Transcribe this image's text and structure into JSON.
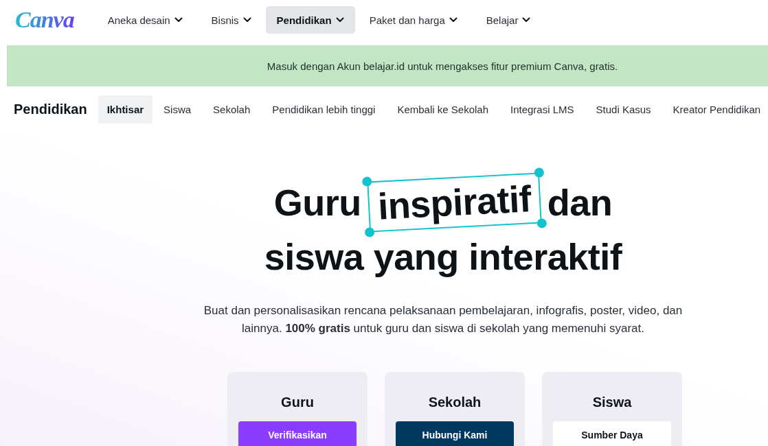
{
  "logo": "Canva",
  "nav": [
    {
      "label": "Aneka desain",
      "selected": false
    },
    {
      "label": "Bisnis",
      "selected": false
    },
    {
      "label": "Pendidikan",
      "selected": true
    },
    {
      "label": "Paket dan harga",
      "selected": false
    },
    {
      "label": "Belajar",
      "selected": false
    }
  ],
  "banner": "Masuk dengan Akun belajar.id untuk mengakses fitur premium Canva, gratis.",
  "subnav": {
    "title": "Pendidikan",
    "tabs": [
      {
        "label": "Ikhtisar",
        "selected": true
      },
      {
        "label": "Siswa",
        "selected": false
      },
      {
        "label": "Sekolah",
        "selected": false
      },
      {
        "label": "Pendidikan lebih tinggi",
        "selected": false
      },
      {
        "label": "Kembali ke Sekolah",
        "selected": false
      },
      {
        "label": "Integrasi LMS",
        "selected": false
      },
      {
        "label": "Studi Kasus",
        "selected": false
      },
      {
        "label": "Kreator Pendidikan",
        "selected": false
      }
    ]
  },
  "hero": {
    "headline": {
      "before": "Guru",
      "highlight": "inspiratif",
      "after": "dan",
      "line2": "siswa yang interaktif"
    },
    "description": "Buat dan personalisasikan rencana pelaksanaan pembelajaran, infografis, poster, video, dan lainnya. **100% gratis** untuk guru dan siswa di sekolah yang memenuhi syarat.",
    "cards": [
      {
        "title": "Guru",
        "button": "Verifikasikan",
        "kind": "primary"
      },
      {
        "title": "Sekolah",
        "button": "Hubungi Kami",
        "kind": "dark"
      },
      {
        "title": "Siswa",
        "button": "Sumber Daya",
        "kind": "light"
      }
    ]
  }
}
